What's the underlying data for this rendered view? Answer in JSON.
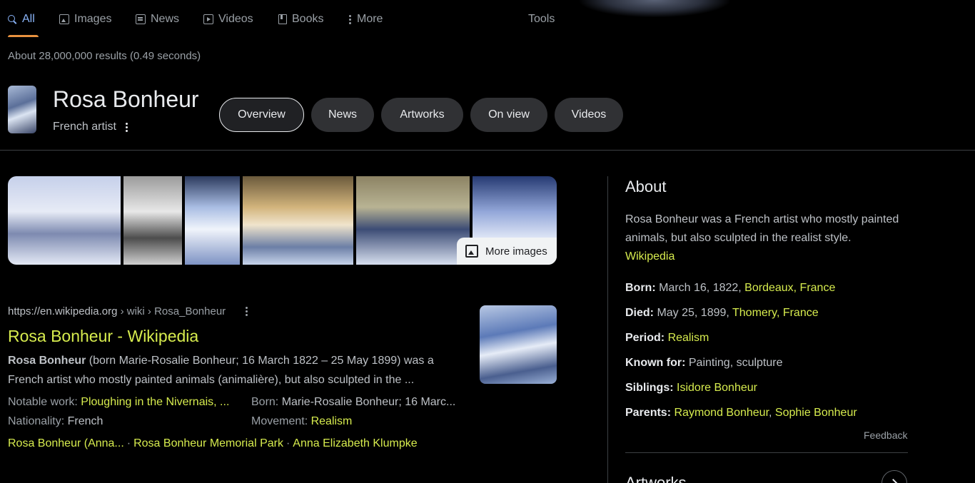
{
  "nav": {
    "tabs": [
      {
        "label": "All",
        "icon": "search-icon",
        "active": true
      },
      {
        "label": "Images",
        "icon": "image-icon"
      },
      {
        "label": "News",
        "icon": "news-icon"
      },
      {
        "label": "Videos",
        "icon": "video-icon"
      },
      {
        "label": "Books",
        "icon": "book-icon"
      },
      {
        "label": "More",
        "icon": "more-vert-icon"
      }
    ],
    "tools": "Tools",
    "accent_color": "#e8913f"
  },
  "stats": "About 28,000,000 results (0.49 seconds)",
  "entity": {
    "name": "Rosa Bonheur",
    "subtitle": "French artist",
    "chips": [
      "Overview",
      "News",
      "Artworks",
      "On view",
      "Videos"
    ]
  },
  "images": {
    "more_label": "More images"
  },
  "result": {
    "url": "https://en.wikipedia.org",
    "crumb": " › wiki › Rosa_Bonheur",
    "title": "Rosa Bonheur - Wikipedia",
    "snippet_bold": "Rosa Bonheur",
    "snippet_rest": " (born Marie-Rosalie Bonheur; 16 March 1822 – 25 May 1899) was a French artist who mostly painted animals (animalière), but also sculpted in the ...",
    "facts": {
      "notable_label": "Notable work: ",
      "notable_value": "Ploughing in the Nivernais, ...",
      "born_label": "Born: ",
      "born_value": "Marie-Rosalie Bonheur; 16 Marc...",
      "nationality_label": "Nationality: ",
      "nationality_value": "French",
      "movement_label": "Movement: ",
      "movement_value": "Realism"
    },
    "sitelinks": [
      "Rosa Bonheur (Anna...",
      "Rosa Bonheur Memorial Park",
      "Anna Elizabeth Klumpke"
    ],
    "link_color": "#d7ec4e"
  },
  "about": {
    "heading": "About",
    "description": "Rosa Bonheur was a French artist who mostly painted animals, but also sculpted in the realist style.",
    "source": "Wikipedia",
    "born_label": "Born:",
    "born_text": " March 16, 1822, ",
    "born_place": "Bordeaux, France",
    "died_label": "Died:",
    "died_text": " May 25, 1899, ",
    "died_place": "Thomery, France",
    "period_label": "Period:",
    "period_value": "Realism",
    "known_label": "Known for:",
    "known_value": " Painting, sculpture",
    "siblings_label": "Siblings:",
    "siblings_value": "Isidore Bonheur",
    "parents_label": "Parents:",
    "parent1": "Raymond Bonheur",
    "parents_sep": ", ",
    "parent2": "Sophie Bonheur",
    "feedback": "Feedback",
    "artworks_heading": "Artworks"
  }
}
